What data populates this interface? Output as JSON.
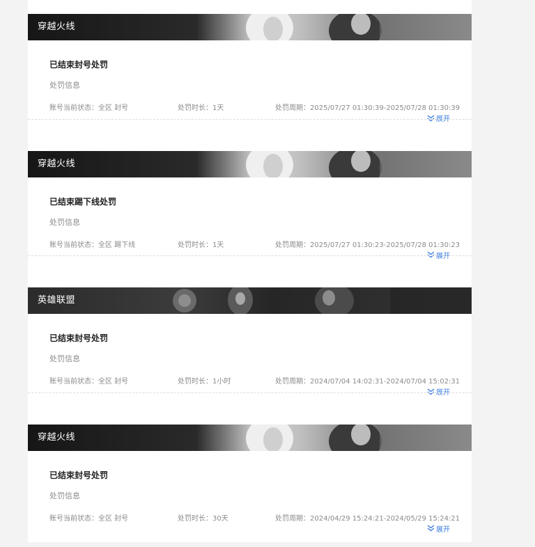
{
  "records": [
    {
      "game": "穿越火线",
      "banner_style": "cf",
      "status_title": "已结束封号处罚",
      "info_label": "处罚信息",
      "state": "账号当前状态：全区 封号",
      "duration": "处罚时长：1天",
      "period": "处罚周期：2025/07/27 01:30:39-2025/07/28 01:30:39",
      "expand_label": "展开"
    },
    {
      "game": "穿越火线",
      "banner_style": "cf",
      "status_title": "已结束踢下线处罚",
      "info_label": "处罚信息",
      "state": "账号当前状态：全区 踢下线",
      "duration": "处罚时长：1天",
      "period": "处罚周期：2025/07/27 01:30:23-2025/07/28 01:30:23",
      "expand_label": "展开"
    },
    {
      "game": "英雄联盟",
      "banner_style": "lol",
      "status_title": "已结束封号处罚",
      "info_label": "处罚信息",
      "state": "账号当前状态：全区 封号",
      "duration": "处罚时长：1小时",
      "period": "处罚周期：2024/07/04 14:02:31-2024/07/04 15:02:31",
      "expand_label": "展开"
    },
    {
      "game": "穿越火线",
      "banner_style": "cf",
      "status_title": "已结束封号处罚",
      "info_label": "处罚信息",
      "state": "账号当前状态：全区 封号",
      "duration": "处罚时长：30天",
      "period": "处罚周期：2024/04/29 15:24:21-2024/05/29 15:24:21",
      "expand_label": "展开"
    }
  ],
  "colors": {
    "accent": "#3a7be0",
    "banner_dark": "#1e1e1e",
    "text_dark": "#222222",
    "text_muted": "#8a8a8a"
  },
  "icons": {
    "expand": "double-chevron-down-icon"
  }
}
